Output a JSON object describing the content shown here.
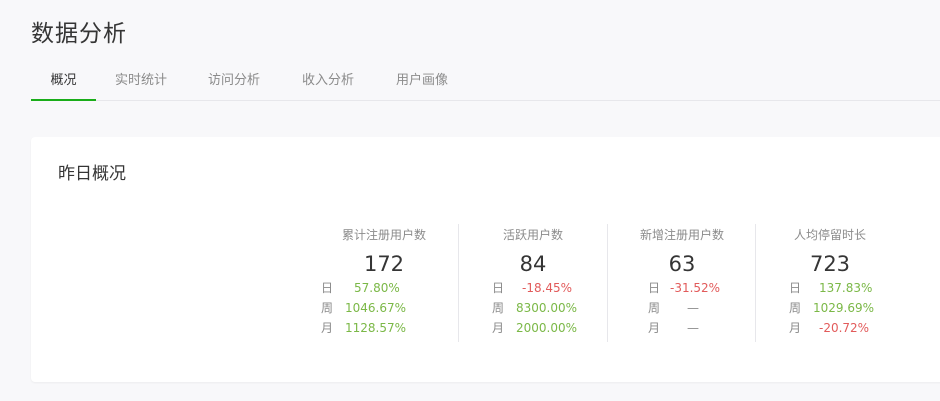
{
  "header": {
    "title": "数据分析"
  },
  "tabs": [
    {
      "label": "概况",
      "active": true
    },
    {
      "label": "实时统计",
      "active": false
    },
    {
      "label": "访问分析",
      "active": false
    },
    {
      "label": "收入分析",
      "active": false
    },
    {
      "label": "用户画像",
      "active": false
    }
  ],
  "overview": {
    "title": "昨日概况",
    "stats": [
      {
        "label": "累计注册用户数",
        "value": "172",
        "rows": [
          {
            "period": "日",
            "change": "57.80%",
            "trend": "up"
          },
          {
            "period": "周",
            "change": "1046.67%",
            "trend": "up"
          },
          {
            "period": "月",
            "change": "1128.57%",
            "trend": "up"
          }
        ]
      },
      {
        "label": "活跃用户数",
        "value": "84",
        "rows": [
          {
            "period": "日",
            "change": "-18.45%",
            "trend": "down"
          },
          {
            "period": "周",
            "change": "8300.00%",
            "trend": "up"
          },
          {
            "period": "月",
            "change": "2000.00%",
            "trend": "up"
          }
        ]
      },
      {
        "label": "新增注册用户数",
        "value": "63",
        "rows": [
          {
            "period": "日",
            "change": "-31.52%",
            "trend": "down"
          },
          {
            "period": "周",
            "change": "—",
            "trend": "none"
          },
          {
            "period": "月",
            "change": "—",
            "trend": "none"
          }
        ]
      },
      {
        "label": "人均停留时长",
        "value": "723",
        "rows": [
          {
            "period": "日",
            "change": "137.83%",
            "trend": "up"
          },
          {
            "period": "周",
            "change": "1029.69%",
            "trend": "up"
          },
          {
            "period": "月",
            "change": "-20.72%",
            "trend": "down"
          }
        ]
      }
    ]
  },
  "colors": {
    "accent": "#1aad19",
    "up": "#7bb847",
    "down": "#e25b5b"
  }
}
